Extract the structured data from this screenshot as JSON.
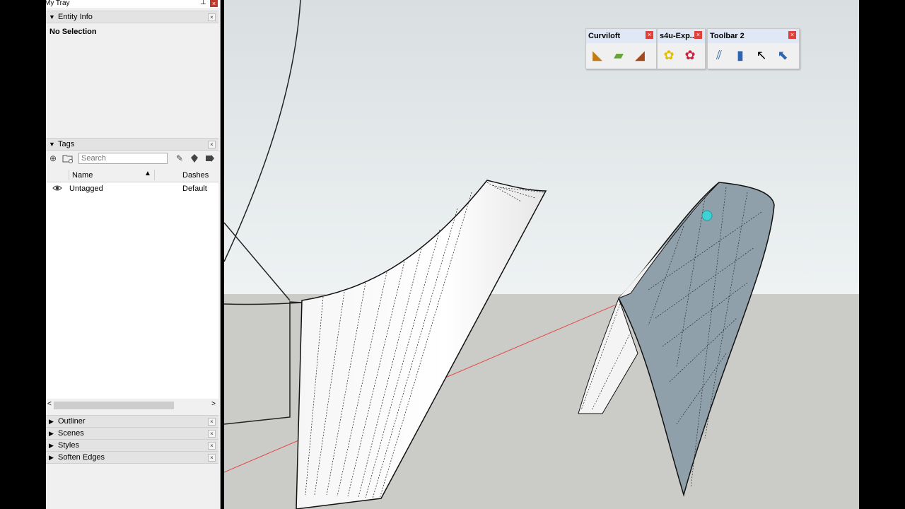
{
  "tray": {
    "title": "My Tray",
    "pin": "⊥",
    "close": "×"
  },
  "panels": {
    "entity_info": {
      "label": "Entity Info",
      "selection": "No Selection"
    },
    "tags": {
      "label": "Tags",
      "search_placeholder": "Search",
      "col_name": "Name",
      "col_dashes": "Dashes",
      "rows": [
        {
          "name": "Untagged",
          "dashes": "Default"
        }
      ]
    },
    "collapsed": [
      "Outliner",
      "Scenes",
      "Styles",
      "Soften Edges"
    ]
  },
  "toolbars": [
    {
      "title": "Curviloft",
      "buttons": [
        "loft-by-spline-icon",
        "skin-contours-icon",
        "loft-along-path-icon"
      ]
    },
    {
      "title": "s4u-Exp...",
      "buttons": [
        "explode-yellow-flower-icon",
        "explode-red-flower-icon"
      ]
    },
    {
      "title": "Toolbar 2",
      "buttons": [
        "parallel-lines-icon",
        "fold-panel-icon",
        "select-cursor-icon",
        "select-box-cursor-icon"
      ]
    }
  ],
  "colors": {
    "sky": "#e4eaec",
    "ground": "#cbcbc7",
    "red_axis": "#e24848",
    "panel_bg": "#f0f0f0",
    "shaded_face": "#90a0ab"
  }
}
